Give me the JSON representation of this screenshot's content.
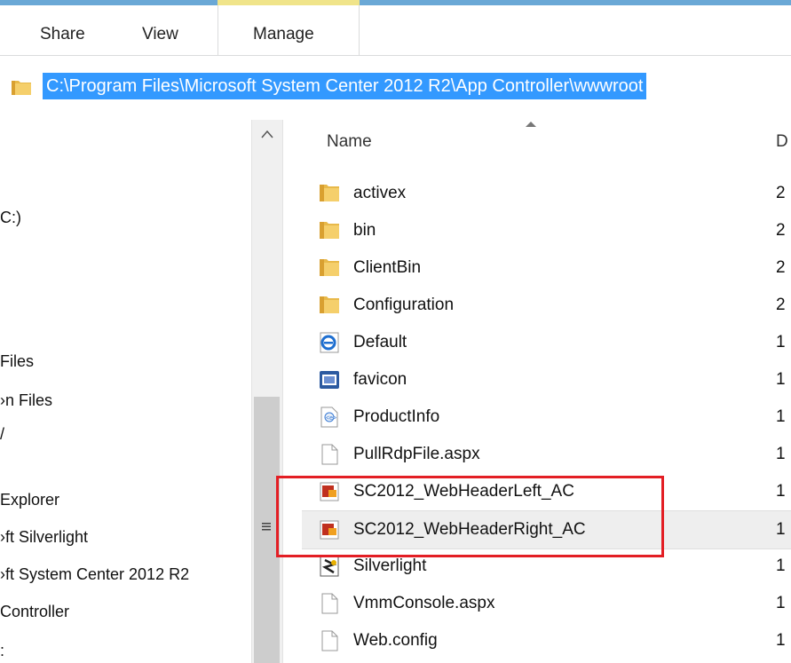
{
  "ribbon": {
    "tabs": [
      {
        "label": "Share"
      },
      {
        "label": "View"
      },
      {
        "label": "Manage"
      }
    ]
  },
  "address": {
    "path": "C:\\Program Files\\Microsoft System Center 2012 R2\\App Controller\\wwwroot"
  },
  "nav": {
    "items": [
      {
        "label": "C:)"
      },
      {
        "label": "Files"
      },
      {
        "label": "›n Files"
      },
      {
        "label": "/"
      },
      {
        "label": " Explorer"
      },
      {
        "label": "›ft Silverlight"
      },
      {
        "label": "›ft System Center 2012 R2"
      },
      {
        "label": "Controller"
      },
      {
        "label": ":"
      }
    ]
  },
  "list": {
    "header": {
      "name": "Name",
      "date": "D"
    },
    "rows": [
      {
        "name": "activex",
        "date": "2",
        "icon": "folder-icon"
      },
      {
        "name": "bin",
        "date": "2",
        "icon": "folder-icon"
      },
      {
        "name": "ClientBin",
        "date": "2",
        "icon": "folder-icon"
      },
      {
        "name": "Configuration",
        "date": "2",
        "icon": "folder-icon"
      },
      {
        "name": "Default",
        "date": "1",
        "icon": "ie-html-icon"
      },
      {
        "name": "favicon",
        "date": "1",
        "icon": "icon-file-icon"
      },
      {
        "name": "ProductInfo",
        "date": "1",
        "icon": "xml-file-icon"
      },
      {
        "name": "PullRdpFile.aspx",
        "date": "1",
        "icon": "blank-file-icon"
      },
      {
        "name": "SC2012_WebHeaderLeft_AC",
        "date": "1",
        "icon": "image-file-icon"
      },
      {
        "name": "SC2012_WebHeaderRight_AC",
        "date": "1",
        "icon": "image-file-icon"
      },
      {
        "name": "Silverlight",
        "date": "1",
        "icon": "silverlight-icon"
      },
      {
        "name": "VmmConsole.aspx",
        "date": "1",
        "icon": "blank-file-icon"
      },
      {
        "name": "Web.config",
        "date": "1",
        "icon": "blank-file-icon"
      }
    ]
  },
  "colors": {
    "selection": "#3399ff",
    "highlight_box": "#e31e24",
    "accent_line": "#6aa8d6"
  }
}
